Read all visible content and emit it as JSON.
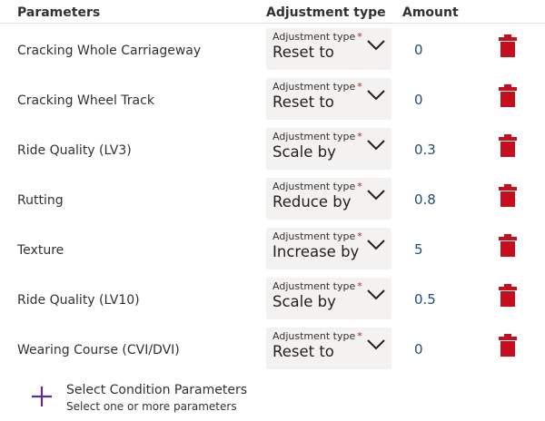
{
  "columns": {
    "parameters": "Parameters",
    "adjustment_type": "Adjustment type",
    "amount": "Amount"
  },
  "rows": [
    {
      "parameter": "Cracking Whole Carriageway",
      "adj_label": "Adjustment type",
      "required": "*",
      "adj_value": "Reset to",
      "amount": "0"
    },
    {
      "parameter": "Cracking Wheel Track",
      "adj_label": "Adjustment type",
      "required": "*",
      "adj_value": "Reset to",
      "amount": "0"
    },
    {
      "parameter": "Ride Quality (LV3)",
      "adj_label": "Adjustment type",
      "required": "*",
      "adj_value": "Scale by",
      "amount": "0.3"
    },
    {
      "parameter": "Rutting",
      "adj_label": "Adjustment type",
      "required": "*",
      "adj_value": "Reduce by",
      "amount": "0.8"
    },
    {
      "parameter": "Texture",
      "adj_label": "Adjustment type",
      "required": "*",
      "adj_value": "Increase by",
      "amount": "5"
    },
    {
      "parameter": "Ride Quality (LV10)",
      "adj_label": "Adjustment type",
      "required": "*",
      "adj_value": "Scale by",
      "amount": "0.5"
    },
    {
      "parameter": "Wearing Course (CVI/DVI)",
      "adj_label": "Adjustment type",
      "required": "*",
      "adj_value": "Reset to",
      "amount": "0"
    }
  ],
  "add_parameters": {
    "title": "Select Condition Parameters",
    "subtitle": "Select one or more parameters"
  },
  "icons": {
    "dropdown": "chevron-down-icon",
    "delete": "trash-icon",
    "add": "plus-icon"
  },
  "colors": {
    "delete_icon": "#c50f1f",
    "add_icon": "#5c2d91",
    "amount_text": "#1f4e79",
    "dropdown_bg": "#f3f2f1",
    "required_marker": "#a4262c"
  }
}
